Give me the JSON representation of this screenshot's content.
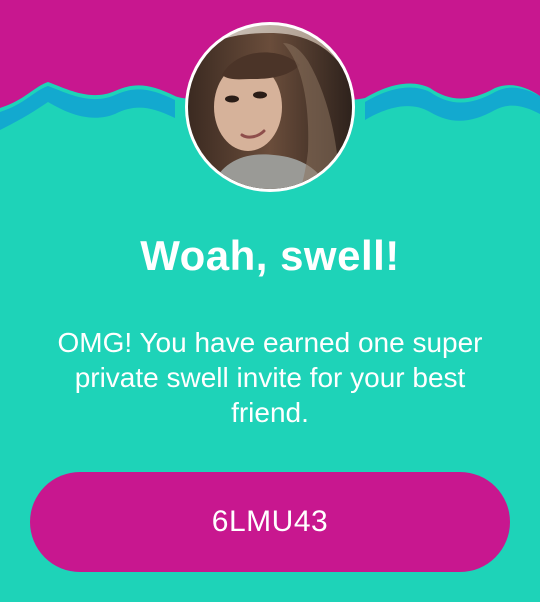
{
  "colors": {
    "background": "#1ed3b8",
    "header": "#c8178f",
    "wave": "#13a9cf",
    "button": "#c8178f",
    "text": "#ffffff"
  },
  "header": {
    "avatar_icon": "profile-photo"
  },
  "main": {
    "headline": "Woah, swell!",
    "message": "OMG! You have earned one super private swell invite for your best friend."
  },
  "invite": {
    "code": "6LMU43"
  }
}
